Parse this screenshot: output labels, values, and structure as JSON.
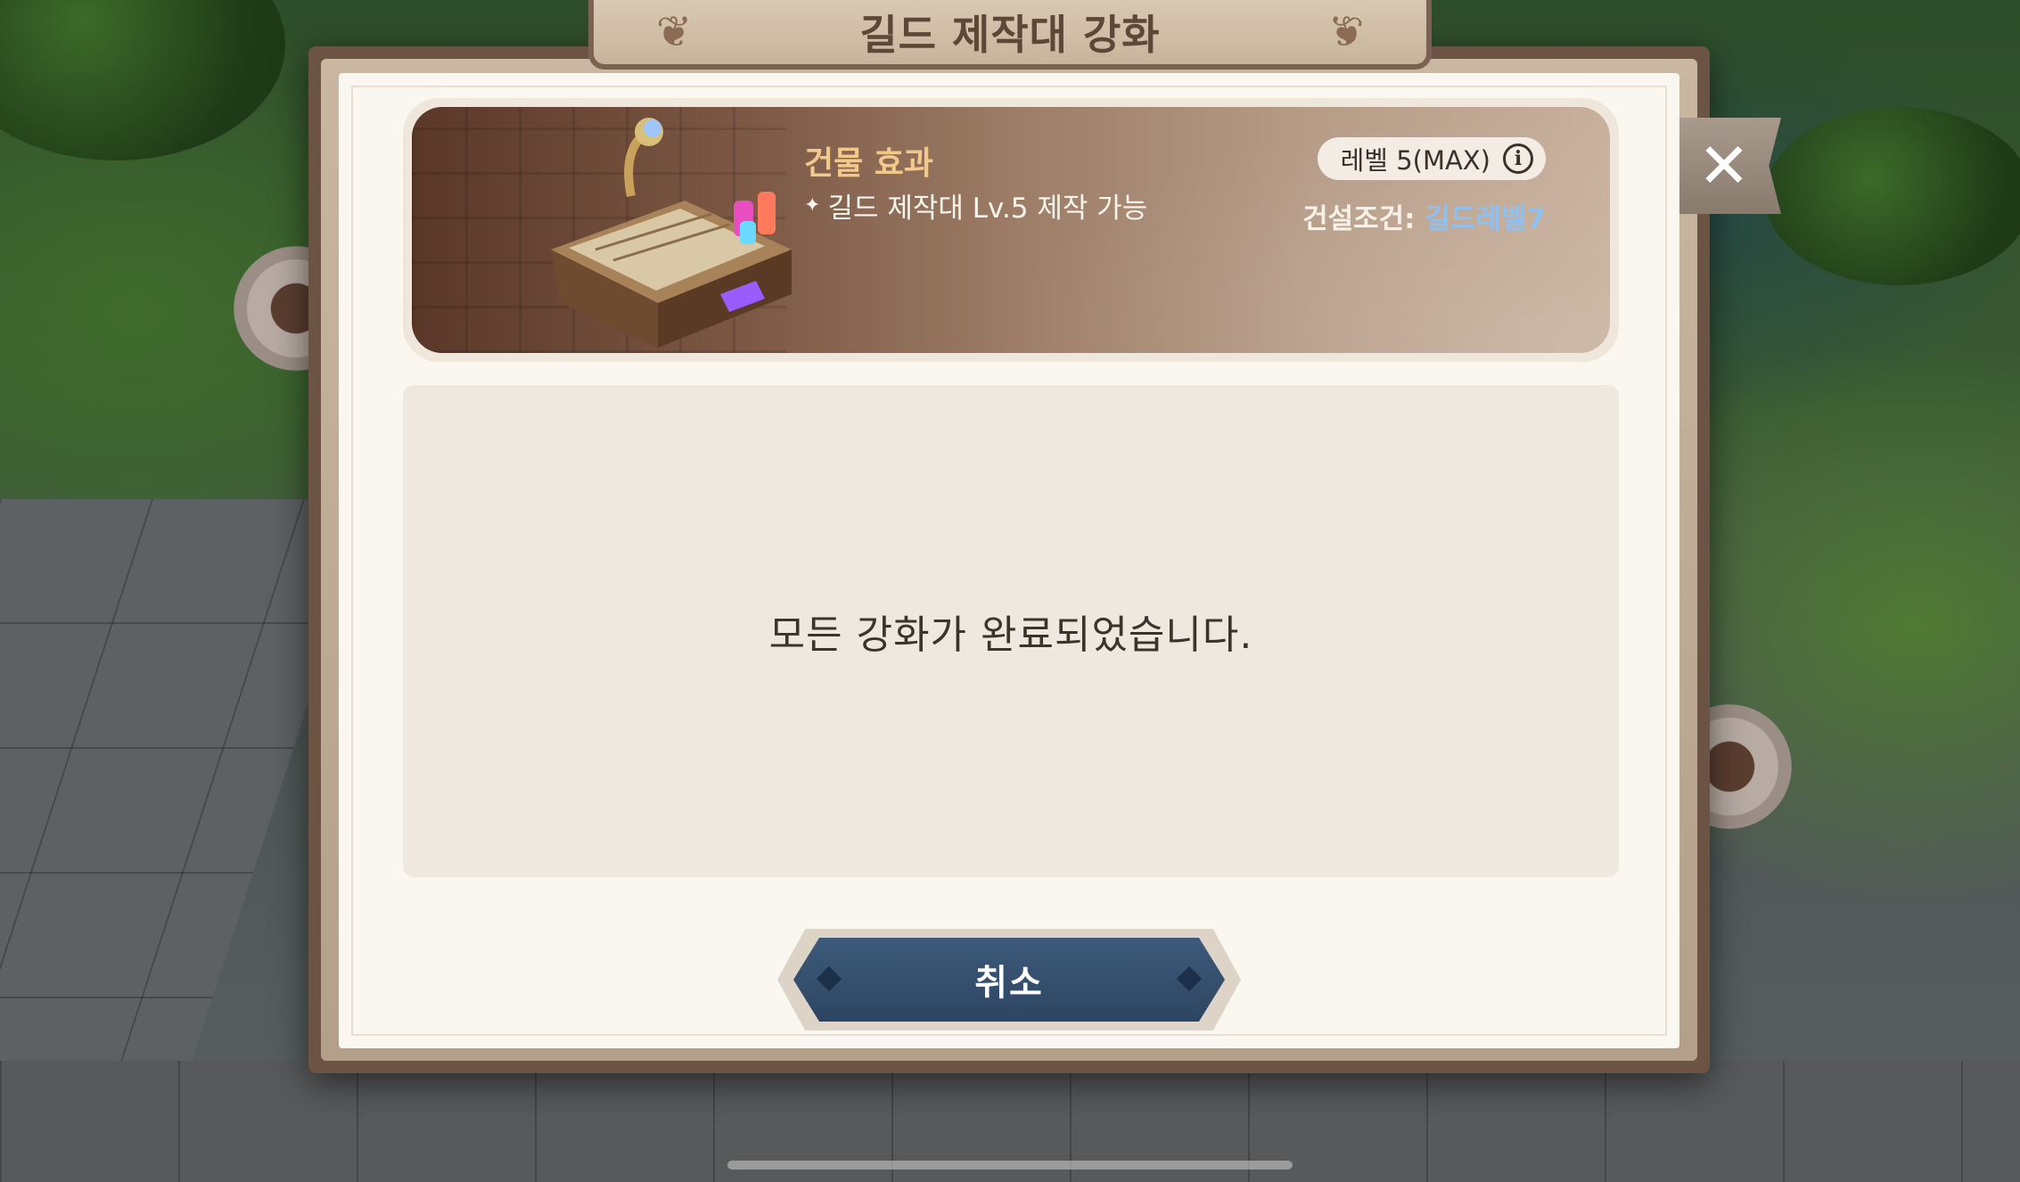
{
  "dialog": {
    "title": "길드 제작대 강화"
  },
  "building": {
    "image_icon": "crafting-table-icon",
    "effect_title": "건물 효과",
    "effect_bullet": "✦",
    "effect_text": "길드 제작대 Lv.5 제작 가능",
    "level_label": "레벨 5(MAX)",
    "info_icon": "info-icon",
    "build_condition_label": "건설조건: ",
    "build_condition_value": "길드레벨7"
  },
  "message": {
    "text": "모든 강화가 완료되었습니다."
  },
  "buttons": {
    "cancel_label": "취소",
    "close_icon": "close-icon"
  },
  "colors": {
    "effect_title": "#f3c98b",
    "build_condition_value": "#8fc0ef",
    "cancel_button": "#2c4562"
  }
}
